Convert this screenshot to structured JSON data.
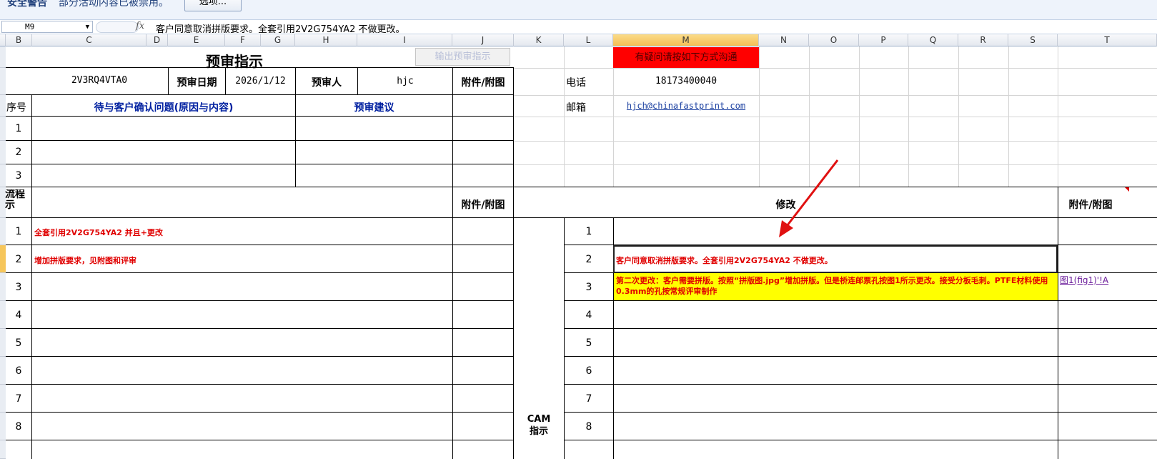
{
  "security_bar": {
    "title": "安全警告",
    "message": "部分活动内容已被禁用。",
    "options_button": "选项..."
  },
  "formula_bar": {
    "name_box": "M9",
    "fx": "fx",
    "content": "客户同意取消拼版要求。全套引用2V2G754YA2 不做更改。"
  },
  "columns": [
    "B",
    "C",
    "D",
    "E",
    "F",
    "G",
    "H",
    "I",
    "J",
    "K",
    "L",
    "M",
    "N",
    "O",
    "P",
    "Q",
    "R",
    "S",
    "T"
  ],
  "selected_column": "M",
  "sheet": {
    "title": "预审指示",
    "output_button": "输出预审指示",
    "contact_header": "有疑问请按如下方式沟通",
    "order_no": "2V3RQ4VTA0",
    "review_date_label": "预审日期",
    "review_date": "2026/1/12",
    "reviewer_label": "预审人",
    "reviewer": "hjc",
    "attachment_label": "附件/附图",
    "phone_label": "电话",
    "phone": "18173400040",
    "email_label": "邮箱",
    "email": "hjch@chinafastprint.com",
    "seq_label": "序号",
    "confirm_header": "待与客户确认问题(原因与内容)",
    "suggest_header": "预审建议",
    "q_rows": [
      "1",
      "2",
      "3"
    ],
    "flow_label": "流程示",
    "modify_header": "修改",
    "attachment_label2": "附件/附图",
    "cam_label": "CAM指示",
    "flow_rows": [
      {
        "n": "1",
        "text": "全套引用2V2G754YA2 并且+更改"
      },
      {
        "n": "2",
        "text": "增加拼版要求，见附图和评审"
      },
      {
        "n": "3",
        "text": ""
      },
      {
        "n": "4",
        "text": ""
      },
      {
        "n": "5",
        "text": ""
      },
      {
        "n": "6",
        "text": ""
      },
      {
        "n": "7",
        "text": ""
      },
      {
        "n": "8",
        "text": ""
      }
    ],
    "cam_rows": [
      {
        "n": "1",
        "text": ""
      },
      {
        "n": "2",
        "text": "客户同意取消拼版要求。全套引用2V2G754YA2 不做更改。"
      },
      {
        "n": "3",
        "text": "第二次更改：客户需要拼版。按照“拼版图.jpg”增加拼版。但是桥连邮票孔按图1所示更改。接受分板毛刺。PTFE材料使用0.3mm的孔按常规评审制作"
      },
      {
        "n": "4",
        "text": ""
      },
      {
        "n": "5",
        "text": ""
      },
      {
        "n": "6",
        "text": ""
      },
      {
        "n": "7",
        "text": ""
      },
      {
        "n": "8",
        "text": ""
      }
    ],
    "row3_attachment_link": "图1(fig1)'!A"
  },
  "colors": {
    "accent_red": "#ff0000",
    "highlight_yellow": "#ffff00",
    "header_blue": "#0020a0",
    "text_red": "#e00000"
  }
}
